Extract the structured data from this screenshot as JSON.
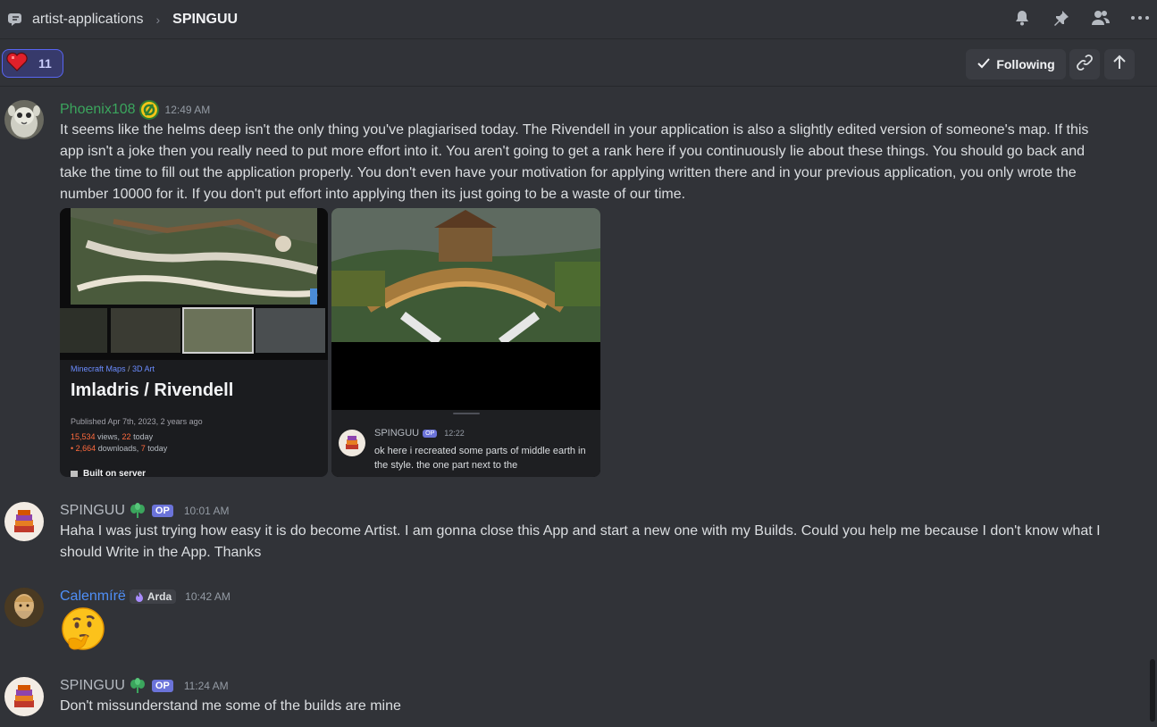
{
  "header": {
    "channel": "artist-applications",
    "separator": "›",
    "thread": "SPINGUU"
  },
  "subbar": {
    "reaction_count": "11",
    "follow_label": "Following"
  },
  "messages": [
    {
      "author": "Phoenix108",
      "time": "12:49 AM",
      "text": "It seems like the helms deep isn't the only thing you've plagiarised today. The Rivendell in your application is also a slightly edited version of someone's map. If this app isn't a joke then you really need to put more effort into it. You aren't going to get a rank here if you continuously lie about these things. You should go back and take the time to fill out the application properly. You don't even have your motivation for applying written there and in your previous application, you only wrote the number 10000 for it. If you don't put effort into applying then its just going to be a waste of our time."
    },
    {
      "author": "SPINGUU",
      "badge": "OP",
      "time": "10:01 AM",
      "text": "Haha I was just trying how easy it is do become Artist. I am gonna close this App and start a new one with my Builds. Could you help me because I don't know what I should Write in the App. Thanks"
    },
    {
      "author": "Calenmírë",
      "role": "Arda",
      "time": "10:42 AM",
      "text": "🤔"
    },
    {
      "author": "SPINGUU",
      "badge": "OP",
      "time": "11:24 AM",
      "text": "Don't missunderstand me some of the builds are mine"
    }
  ],
  "attachment1": {
    "category": "Minecraft Maps",
    "category_sep": " / ",
    "subcategory": "3D Art",
    "title": "Imladris / Rivendell",
    "published": "Published Apr 7th, 2023, 2 years ago",
    "views_num": "15,534",
    "views_label": " views, ",
    "views_today": "22",
    "views_today_label": " today",
    "downloads_prefix": "• ",
    "downloads_num": "2,664",
    "downloads_label": " downloads, ",
    "downloads_today": "7",
    "downloads_today_label": " today",
    "built_on": "Built on server"
  },
  "attachment2": {
    "author": "SPINGUU",
    "badge": "OP",
    "time": "12:22",
    "text": "ok here i recreated some parts of middle earth in the style. the one part next to the"
  },
  "colors": {
    "phoenix_name": "#3ba55d",
    "calen_name": "#4f8ff7",
    "spinguu_name": "#b5bac1",
    "accent": "#5865f2"
  }
}
